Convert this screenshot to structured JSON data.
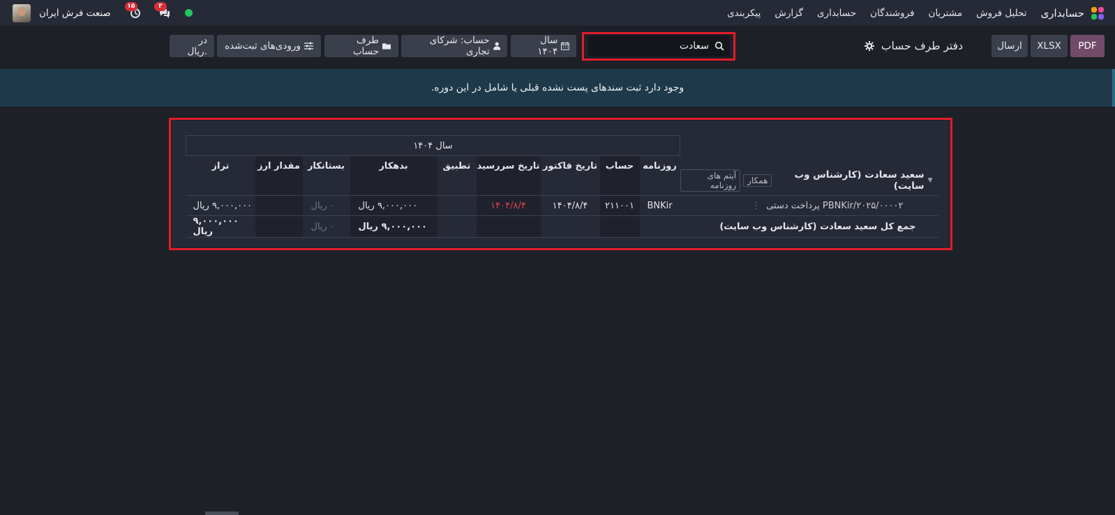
{
  "navbar": {
    "app_name": "حسابداری",
    "menu": [
      "تحلیل فروش",
      "مشتریان",
      "فروشندگان",
      "حسابداری",
      "گزارش",
      "پیکربندی"
    ],
    "company": "صنعت فرش ایران",
    "activity_badge": "۱۵",
    "messages_badge": "۳"
  },
  "control": {
    "pdf_label": "PDF",
    "xlsx_label": "XLSX",
    "send_label": "ارسال",
    "title": "دفتر طرف حساب",
    "search_value": "سعادت",
    "filter_year": "سال ۱۴۰۴",
    "filter_account": "حساب: شرکای تجاری",
    "filter_partner": "طرف حساب",
    "filter_posted": "ورودی‌های ثبت‌شده",
    "filter_currency": "در .ریال"
  },
  "alert": {
    "text": "وجود دارد ثبت سندهای پست نشده قبلی یا شامل در این دوره."
  },
  "report": {
    "period": "سال ۱۴۰۴",
    "columns": [
      "روزنامه",
      "حساب",
      "تاریخ فاکتور",
      "تاریخ سررسید",
      "تطبیق",
      "بدهکار",
      "بستانکار",
      "مقدار ارز",
      "تراز"
    ],
    "partner": {
      "name": "سعید سعادت (کارشناس وب سایت)",
      "tag_colleague": "همکار",
      "tag_journal_items": "آیتم های روزنامه"
    },
    "rows": [
      {
        "label": "PBNKir/۲۰۲۵/۰۰۰۰۲ پرداخت دستی",
        "journal": "BNKir",
        "account": "۲۱۱۰۰۱",
        "invoice_date": "۱۴۰۴/۸/۴",
        "due_date": "۱۴۰۴/۸/۴",
        "matching": "",
        "debit": "۹,۰۰۰,۰۰۰ ریال",
        "credit": "۰ ریال",
        "amount_currency": "",
        "balance": "۹,۰۰۰,۰۰۰ ریال"
      }
    ],
    "total": {
      "label": "جمع کل سعید سعادت (کارشناس وب سایت)",
      "debit": "۹,۰۰۰,۰۰۰ ریال",
      "credit": "۰ ریال",
      "balance": "۹,۰۰۰,۰۰۰ ریال"
    }
  },
  "colors": {
    "highlight": "#e11d2a",
    "pdf": "#714b67",
    "alert_bg": "#1e3a4a",
    "overdue": "#e0424b"
  }
}
